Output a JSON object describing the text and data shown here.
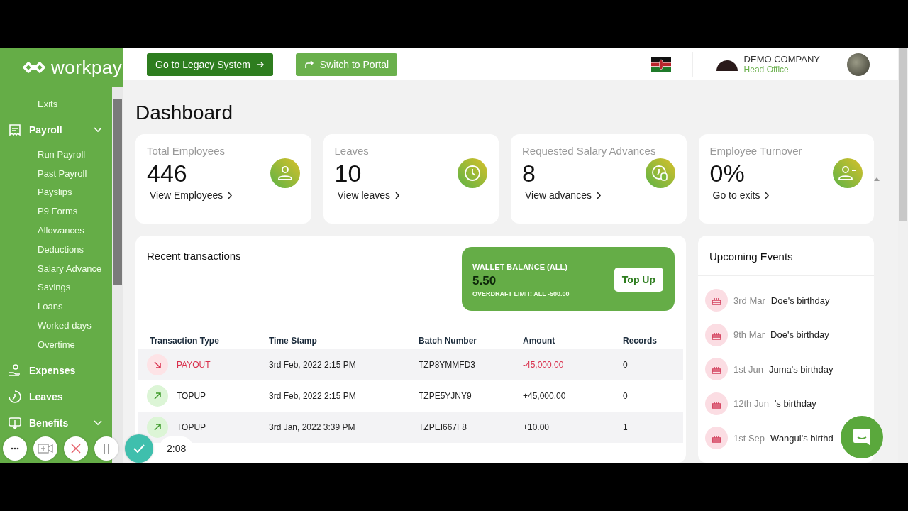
{
  "logo": {
    "text": "workpay"
  },
  "header": {
    "buttons": [
      {
        "label": "Go to Legacy System",
        "kind": "primary"
      },
      {
        "label": "Switch to Portal",
        "kind": "secondary"
      }
    ],
    "company": {
      "name": "DEMO COMPANY",
      "branch": "Head Office"
    }
  },
  "sidebar": {
    "items": [
      {
        "label": "Exits",
        "kind": "sub"
      },
      {
        "label": "Payroll",
        "kind": "menu",
        "children": [
          {
            "label": "Run Payroll"
          },
          {
            "label": "Past Payroll"
          },
          {
            "label": "Payslips"
          },
          {
            "label": "P9 Forms"
          },
          {
            "label": "Allowances"
          },
          {
            "label": "Deductions"
          },
          {
            "label": "Salary Advance"
          },
          {
            "label": "Savings"
          },
          {
            "label": "Loans"
          },
          {
            "label": "Worked days"
          },
          {
            "label": "Overtime"
          }
        ]
      },
      {
        "label": "Expenses",
        "kind": "link"
      },
      {
        "label": "Leaves",
        "kind": "link"
      },
      {
        "label": "Benefits",
        "kind": "menu"
      }
    ]
  },
  "page": {
    "title": "Dashboard"
  },
  "stats": [
    {
      "title": "Total Employees",
      "value": "446",
      "link": "View Employees"
    },
    {
      "title": "Leaves",
      "value": "10",
      "link": "View leaves"
    },
    {
      "title": "Requested Salary Advances",
      "value": "8",
      "link": "View advances"
    },
    {
      "title": "Employee Turnover",
      "value": "0%",
      "link": "Go to exits"
    }
  ],
  "transactions": {
    "title": "Recent transactions",
    "wallet": {
      "label": "WALLET BALANCE (ALL)",
      "balance": "5.50",
      "overdraft": "OVERDRAFT LIMIT: ALL -500.00",
      "button": "Top Up"
    },
    "columns": [
      "Transaction Type",
      "Time Stamp",
      "Batch Number",
      "Amount",
      "Records"
    ],
    "rows": [
      {
        "type": "PAYOUT",
        "kind": "out",
        "time": "3rd Feb, 2022 2:15 PM",
        "batch": "TZP8YMMFD3",
        "amount": "-45,000.00",
        "records": "0"
      },
      {
        "type": "TOPUP",
        "kind": "in",
        "time": "3rd Feb, 2022 2:15 PM",
        "batch": "TZPE5YJNY9",
        "amount": "+45,000.00",
        "records": "0"
      },
      {
        "type": "TOPUP",
        "kind": "in",
        "time": "3rd Jan, 2022 3:39 PM",
        "batch": "TZPEI667F8",
        "amount": "+10.00",
        "records": "1"
      }
    ]
  },
  "events": {
    "title": "Upcoming Events",
    "items": [
      {
        "date": "3rd Mar",
        "text": "Doe's birthday"
      },
      {
        "date": "9th Mar",
        "text": "Doe's birthday"
      },
      {
        "date": "1st Jun",
        "text": "Juma's birthday"
      },
      {
        "date": "12th Jun",
        "text": "'s birthday"
      },
      {
        "date": "1st Sep",
        "text": "Wangui's birthd"
      }
    ]
  },
  "recorder": {
    "time": "2:08"
  }
}
